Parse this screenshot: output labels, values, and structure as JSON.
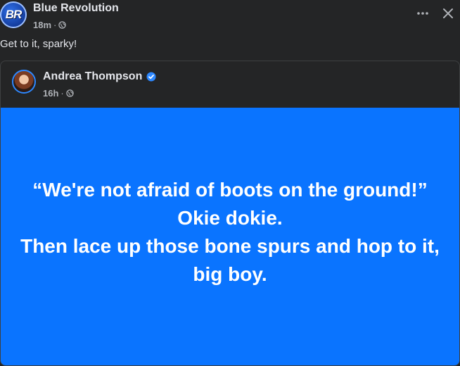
{
  "post": {
    "avatar_text": "BR",
    "page_name": "Blue Revolution",
    "time": "18m",
    "separator": "·",
    "caption": "Get to it, sparky!"
  },
  "shared_post": {
    "author": "Andrea Thompson",
    "time": "16h",
    "separator": "·",
    "text_lines": [
      "“We're not afraid of boots on the ground!”",
      "Okie dokie.",
      "Then lace up those bone spurs and hop to it, big boy."
    ],
    "background_color": "#0a74ff"
  },
  "icons": {
    "more": "more-options-icon",
    "close": "close-icon",
    "audience": "globe-icon",
    "verified": "verified-badge-icon"
  },
  "colors": {
    "background": "#242526",
    "text_primary": "#e4e6eb",
    "text_secondary": "#b0b3b8",
    "verified": "#2d88ff"
  }
}
